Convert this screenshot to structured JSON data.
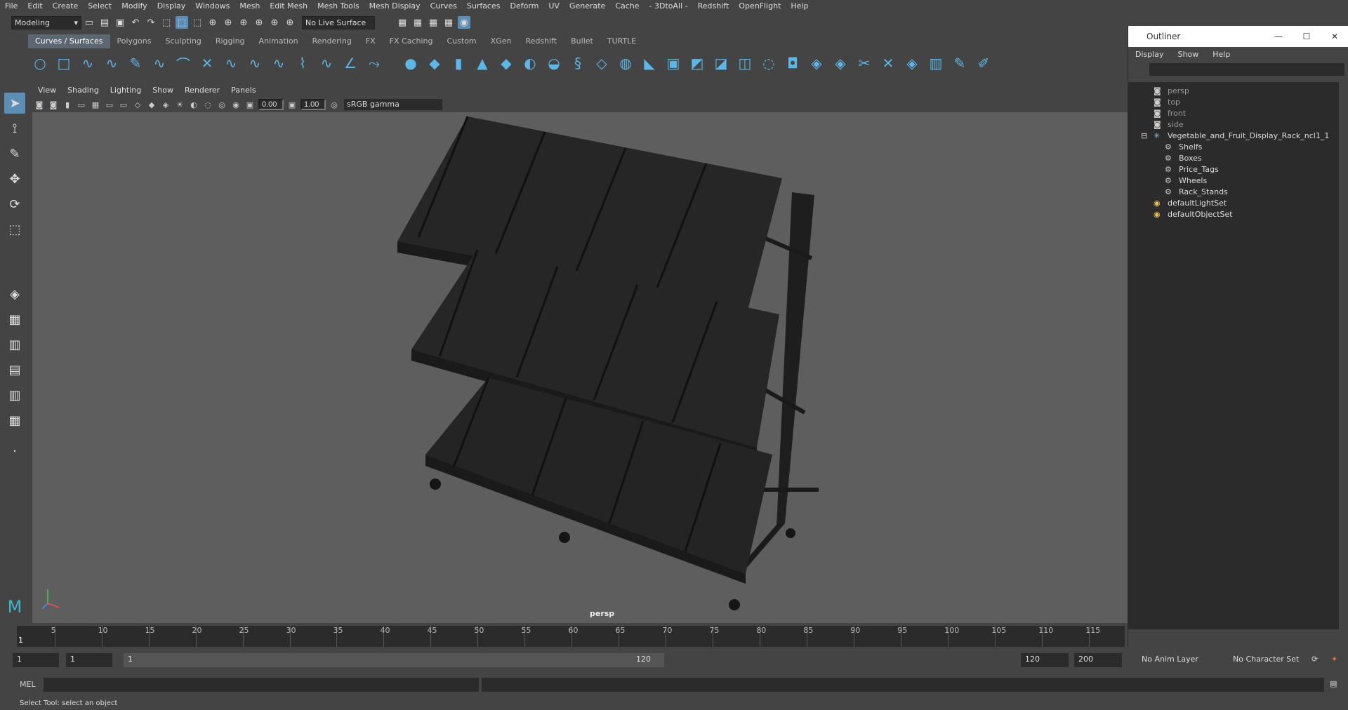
{
  "menubar": [
    "File",
    "Edit",
    "Create",
    "Select",
    "Modify",
    "Display",
    "Windows",
    "Mesh",
    "Edit Mesh",
    "Mesh Tools",
    "Mesh Display",
    "Curves",
    "Surfaces",
    "Deform",
    "UV",
    "Generate",
    "Cache",
    "- 3DtoAll -",
    "Redshift",
    "OpenFlight",
    "Help"
  ],
  "statusline": {
    "mode": "Modeling",
    "live_surface": "No Live Surface"
  },
  "shelf_tabs": [
    "Curves / Surfaces",
    "Polygons",
    "Sculpting",
    "Rigging",
    "Animation",
    "Rendering",
    "FX",
    "FX Caching",
    "Custom",
    "XGen",
    "Redshift",
    "Bullet",
    "TURTLE"
  ],
  "shelf_active": "Curves / Surfaces",
  "panel_menu": [
    "View",
    "Shading",
    "Lighting",
    "Show",
    "Renderer",
    "Panels"
  ],
  "panel_toolbar": {
    "exposure": "0.00",
    "gamma": "1.00",
    "color_space": "sRGB gamma"
  },
  "viewport": {
    "camera_label": "persp"
  },
  "outliner": {
    "title": "Outliner",
    "menu": [
      "Display",
      "Show",
      "Help"
    ],
    "nodes": [
      {
        "label": "persp",
        "indent": 0,
        "type": "camera",
        "dim": true
      },
      {
        "label": "top",
        "indent": 0,
        "type": "camera",
        "dim": true
      },
      {
        "label": "front",
        "indent": 0,
        "type": "camera",
        "dim": true
      },
      {
        "label": "side",
        "indent": 0,
        "type": "camera",
        "dim": true
      },
      {
        "label": "Vegetable_and_Fruit_Display_Rack_ncl1_1",
        "indent": 0,
        "type": "group",
        "dim": false
      },
      {
        "label": "Shelfs",
        "indent": 1,
        "type": "transform",
        "dim": false
      },
      {
        "label": "Boxes",
        "indent": 1,
        "type": "transform",
        "dim": false
      },
      {
        "label": "Price_Tags",
        "indent": 1,
        "type": "transform",
        "dim": false
      },
      {
        "label": "Wheels",
        "indent": 1,
        "type": "transform",
        "dim": false
      },
      {
        "label": "Rack_Stands",
        "indent": 1,
        "type": "transform",
        "dim": false
      },
      {
        "label": "defaultLightSet",
        "indent": 0,
        "type": "set",
        "dim": false
      },
      {
        "label": "defaultObjectSet",
        "indent": 0,
        "type": "set",
        "dim": false
      }
    ]
  },
  "timeline": {
    "ticks": [
      "5",
      "10",
      "15",
      "20",
      "25",
      "30",
      "35",
      "40",
      "45",
      "50",
      "55",
      "60",
      "65",
      "70",
      "75",
      "80",
      "85",
      "90",
      "95",
      "100",
      "105",
      "110",
      "115"
    ],
    "current": "1"
  },
  "range": {
    "start": "1",
    "start2": "1",
    "range_start": "1",
    "range_end": "120",
    "end": "120",
    "end2": "200",
    "anim_layer": "No Anim Layer",
    "char_set": "No Character Set"
  },
  "mel": {
    "label": "MEL"
  },
  "helpline": "Select Tool: select an object",
  "colors": {
    "accent": "#5d8eb5",
    "shelf_icon": "#5cb6e6",
    "viewport_bg": "#5e5e5e"
  }
}
